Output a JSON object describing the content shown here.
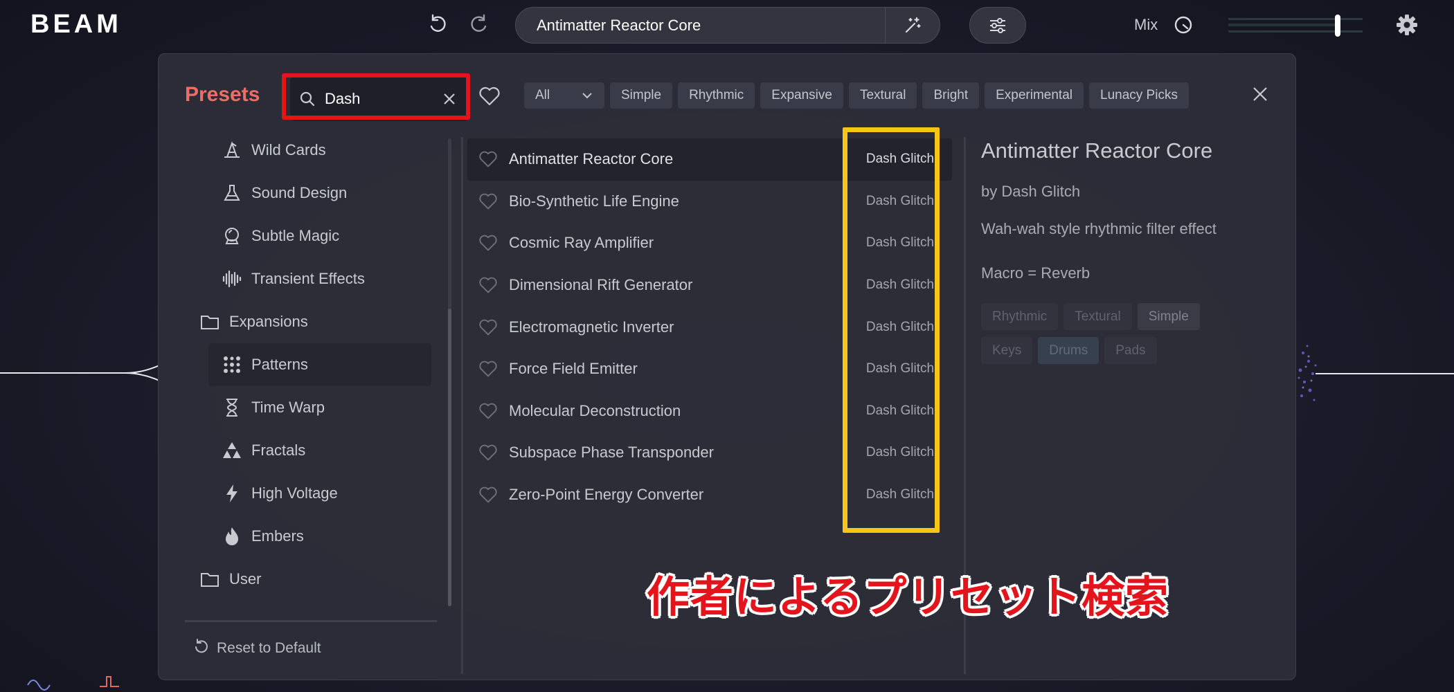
{
  "app": {
    "logo": "BEAM"
  },
  "header": {
    "current_preset": "Antimatter Reactor Core",
    "mix_label": "Mix"
  },
  "presets": {
    "title": "Presets",
    "search": {
      "value": "Dash",
      "placeholder": ""
    },
    "filters": [
      "Simple",
      "Rhythmic",
      "Expansive",
      "Textural",
      "Bright",
      "Experimental",
      "Lunacy Picks"
    ],
    "filter_dropdown": "All",
    "sidebar": [
      {
        "label": "Wild Cards",
        "icon": "wizard-hat-icon",
        "type": "sub"
      },
      {
        "label": "Sound Design",
        "icon": "flask-icon",
        "type": "sub"
      },
      {
        "label": "Subtle Magic",
        "icon": "crystal-ball-icon",
        "type": "sub"
      },
      {
        "label": "Transient Effects",
        "icon": "waveform-icon",
        "type": "sub"
      },
      {
        "label": "Expansions",
        "icon": "folder-icon",
        "type": "folder"
      },
      {
        "label": "Patterns",
        "icon": "dots-grid-icon",
        "type": "sub",
        "selected": true
      },
      {
        "label": "Time Warp",
        "icon": "hourglass-icon",
        "type": "sub"
      },
      {
        "label": "Fractals",
        "icon": "triangle-fractal-icon",
        "type": "sub"
      },
      {
        "label": "High Voltage",
        "icon": "lightning-icon",
        "type": "sub"
      },
      {
        "label": "Embers",
        "icon": "flame-icon",
        "type": "sub"
      },
      {
        "label": "User",
        "icon": "folder-icon",
        "type": "folder"
      }
    ],
    "reset_label": "Reset to Default",
    "list": [
      {
        "name": "Antimatter Reactor Core",
        "author": "Dash Glitch"
      },
      {
        "name": "Bio-Synthetic Life Engine",
        "author": "Dash Glitch"
      },
      {
        "name": "Cosmic Ray Amplifier",
        "author": "Dash Glitch"
      },
      {
        "name": "Dimensional Rift Generator",
        "author": "Dash Glitch"
      },
      {
        "name": "Electromagnetic Inverter",
        "author": "Dash Glitch"
      },
      {
        "name": "Force Field Emitter",
        "author": "Dash Glitch"
      },
      {
        "name": "Molecular Deconstruction",
        "author": "Dash Glitch"
      },
      {
        "name": "Subspace Phase Transponder",
        "author": "Dash Glitch"
      },
      {
        "name": "Zero-Point Energy Converter",
        "author": "Dash Glitch"
      }
    ],
    "detail": {
      "title": "Antimatter Reactor Core",
      "author": "by Dash Glitch",
      "description": "Wah-wah style rhythmic filter effect",
      "macro": "Macro = Reverb",
      "tags": [
        {
          "label": "Rhythmic",
          "style": "dim"
        },
        {
          "label": "Textural",
          "style": "dim"
        },
        {
          "label": "Simple",
          "style": "normal"
        },
        {
          "label": "Keys",
          "style": "dim"
        },
        {
          "label": "Drums",
          "style": "blue"
        },
        {
          "label": "Pads",
          "style": "dim"
        }
      ]
    }
  },
  "annotation": "作者によるプリセット検索",
  "colors": {
    "accent": "#ec6e64",
    "search_highlight": "#e3141b",
    "author_highlight": "#f5c518"
  }
}
